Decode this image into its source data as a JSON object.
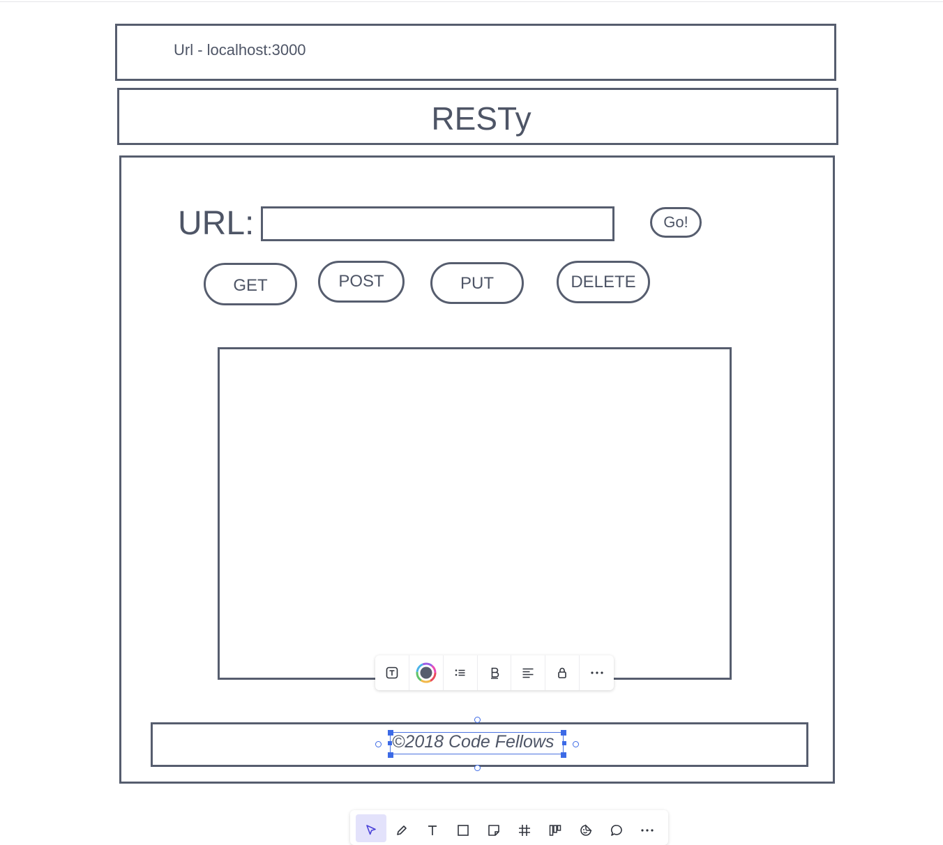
{
  "wireframe": {
    "url_bar_text": "Url - localhost:3000",
    "app_title": "RESTy",
    "url_label": "URL:",
    "url_input_value": "",
    "go_label": "Go!",
    "methods": [
      "GET",
      "POST",
      "PUT",
      "DELETE"
    ],
    "footer_text": "©2018 Code Fellows"
  },
  "format_toolbar": {
    "items": [
      "text-style-icon",
      "color-picker-icon",
      "list-icon",
      "bold-icon",
      "align-icon",
      "lock-icon",
      "more-icon"
    ],
    "current_color": "#565d6e"
  },
  "bottom_toolbar": {
    "items": [
      "select-cursor-icon",
      "pen-icon",
      "text-tool-icon",
      "rectangle-icon",
      "sticky-note-icon",
      "frame-icon",
      "kanban-icon",
      "sticker-icon",
      "comment-icon",
      "more-icon"
    ],
    "active": "select-cursor-icon"
  },
  "colors": {
    "stroke": "#565d6e",
    "selection": "#3c6ae6",
    "active_tool_bg": "#e3e2fb"
  }
}
